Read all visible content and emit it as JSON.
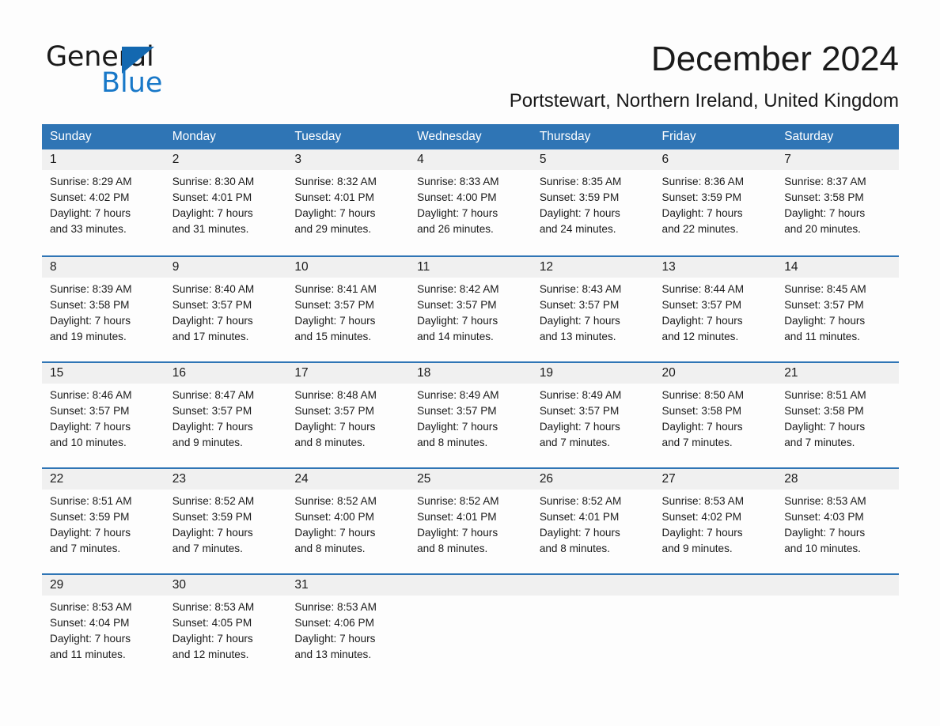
{
  "brand": {
    "name_part1": "General",
    "name_part2": "Blue",
    "triangle_color": "#1368b0",
    "blue_color": "#1878c8"
  },
  "header": {
    "title": "December 2024",
    "subtitle": "Portstewart, Northern Ireland, United Kingdom",
    "header_bg_color": "#2f75b5",
    "daynum_strip_color": "#f0f0f0"
  },
  "weekday_headers": [
    "Sunday",
    "Monday",
    "Tuesday",
    "Wednesday",
    "Thursday",
    "Friday",
    "Saturday"
  ],
  "weeks": [
    [
      {
        "day": "1",
        "info": "Sunrise: 8:29 AM\nSunset: 4:02 PM\nDaylight: 7 hours\nand 33 minutes."
      },
      {
        "day": "2",
        "info": "Sunrise: 8:30 AM\nSunset: 4:01 PM\nDaylight: 7 hours\nand 31 minutes."
      },
      {
        "day": "3",
        "info": "Sunrise: 8:32 AM\nSunset: 4:01 PM\nDaylight: 7 hours\nand 29 minutes."
      },
      {
        "day": "4",
        "info": "Sunrise: 8:33 AM\nSunset: 4:00 PM\nDaylight: 7 hours\nand 26 minutes."
      },
      {
        "day": "5",
        "info": "Sunrise: 8:35 AM\nSunset: 3:59 PM\nDaylight: 7 hours\nand 24 minutes."
      },
      {
        "day": "6",
        "info": "Sunrise: 8:36 AM\nSunset: 3:59 PM\nDaylight: 7 hours\nand 22 minutes."
      },
      {
        "day": "7",
        "info": "Sunrise: 8:37 AM\nSunset: 3:58 PM\nDaylight: 7 hours\nand 20 minutes."
      }
    ],
    [
      {
        "day": "8",
        "info": "Sunrise: 8:39 AM\nSunset: 3:58 PM\nDaylight: 7 hours\nand 19 minutes."
      },
      {
        "day": "9",
        "info": "Sunrise: 8:40 AM\nSunset: 3:57 PM\nDaylight: 7 hours\nand 17 minutes."
      },
      {
        "day": "10",
        "info": "Sunrise: 8:41 AM\nSunset: 3:57 PM\nDaylight: 7 hours\nand 15 minutes."
      },
      {
        "day": "11",
        "info": "Sunrise: 8:42 AM\nSunset: 3:57 PM\nDaylight: 7 hours\nand 14 minutes."
      },
      {
        "day": "12",
        "info": "Sunrise: 8:43 AM\nSunset: 3:57 PM\nDaylight: 7 hours\nand 13 minutes."
      },
      {
        "day": "13",
        "info": "Sunrise: 8:44 AM\nSunset: 3:57 PM\nDaylight: 7 hours\nand 12 minutes."
      },
      {
        "day": "14",
        "info": "Sunrise: 8:45 AM\nSunset: 3:57 PM\nDaylight: 7 hours\nand 11 minutes."
      }
    ],
    [
      {
        "day": "15",
        "info": "Sunrise: 8:46 AM\nSunset: 3:57 PM\nDaylight: 7 hours\nand 10 minutes."
      },
      {
        "day": "16",
        "info": "Sunrise: 8:47 AM\nSunset: 3:57 PM\nDaylight: 7 hours\nand 9 minutes."
      },
      {
        "day": "17",
        "info": "Sunrise: 8:48 AM\nSunset: 3:57 PM\nDaylight: 7 hours\nand 8 minutes."
      },
      {
        "day": "18",
        "info": "Sunrise: 8:49 AM\nSunset: 3:57 PM\nDaylight: 7 hours\nand 8 minutes."
      },
      {
        "day": "19",
        "info": "Sunrise: 8:49 AM\nSunset: 3:57 PM\nDaylight: 7 hours\nand 7 minutes."
      },
      {
        "day": "20",
        "info": "Sunrise: 8:50 AM\nSunset: 3:58 PM\nDaylight: 7 hours\nand 7 minutes."
      },
      {
        "day": "21",
        "info": "Sunrise: 8:51 AM\nSunset: 3:58 PM\nDaylight: 7 hours\nand 7 minutes."
      }
    ],
    [
      {
        "day": "22",
        "info": "Sunrise: 8:51 AM\nSunset: 3:59 PM\nDaylight: 7 hours\nand 7 minutes."
      },
      {
        "day": "23",
        "info": "Sunrise: 8:52 AM\nSunset: 3:59 PM\nDaylight: 7 hours\nand 7 minutes."
      },
      {
        "day": "24",
        "info": "Sunrise: 8:52 AM\nSunset: 4:00 PM\nDaylight: 7 hours\nand 8 minutes."
      },
      {
        "day": "25",
        "info": "Sunrise: 8:52 AM\nSunset: 4:01 PM\nDaylight: 7 hours\nand 8 minutes."
      },
      {
        "day": "26",
        "info": "Sunrise: 8:52 AM\nSunset: 4:01 PM\nDaylight: 7 hours\nand 8 minutes."
      },
      {
        "day": "27",
        "info": "Sunrise: 8:53 AM\nSunset: 4:02 PM\nDaylight: 7 hours\nand 9 minutes."
      },
      {
        "day": "28",
        "info": "Sunrise: 8:53 AM\nSunset: 4:03 PM\nDaylight: 7 hours\nand 10 minutes."
      }
    ],
    [
      {
        "day": "29",
        "info": "Sunrise: 8:53 AM\nSunset: 4:04 PM\nDaylight: 7 hours\nand 11 minutes."
      },
      {
        "day": "30",
        "info": "Sunrise: 8:53 AM\nSunset: 4:05 PM\nDaylight: 7 hours\nand 12 minutes."
      },
      {
        "day": "31",
        "info": "Sunrise: 8:53 AM\nSunset: 4:06 PM\nDaylight: 7 hours\nand 13 minutes."
      },
      {
        "day": "",
        "info": ""
      },
      {
        "day": "",
        "info": ""
      },
      {
        "day": "",
        "info": ""
      },
      {
        "day": "",
        "info": ""
      }
    ]
  ]
}
